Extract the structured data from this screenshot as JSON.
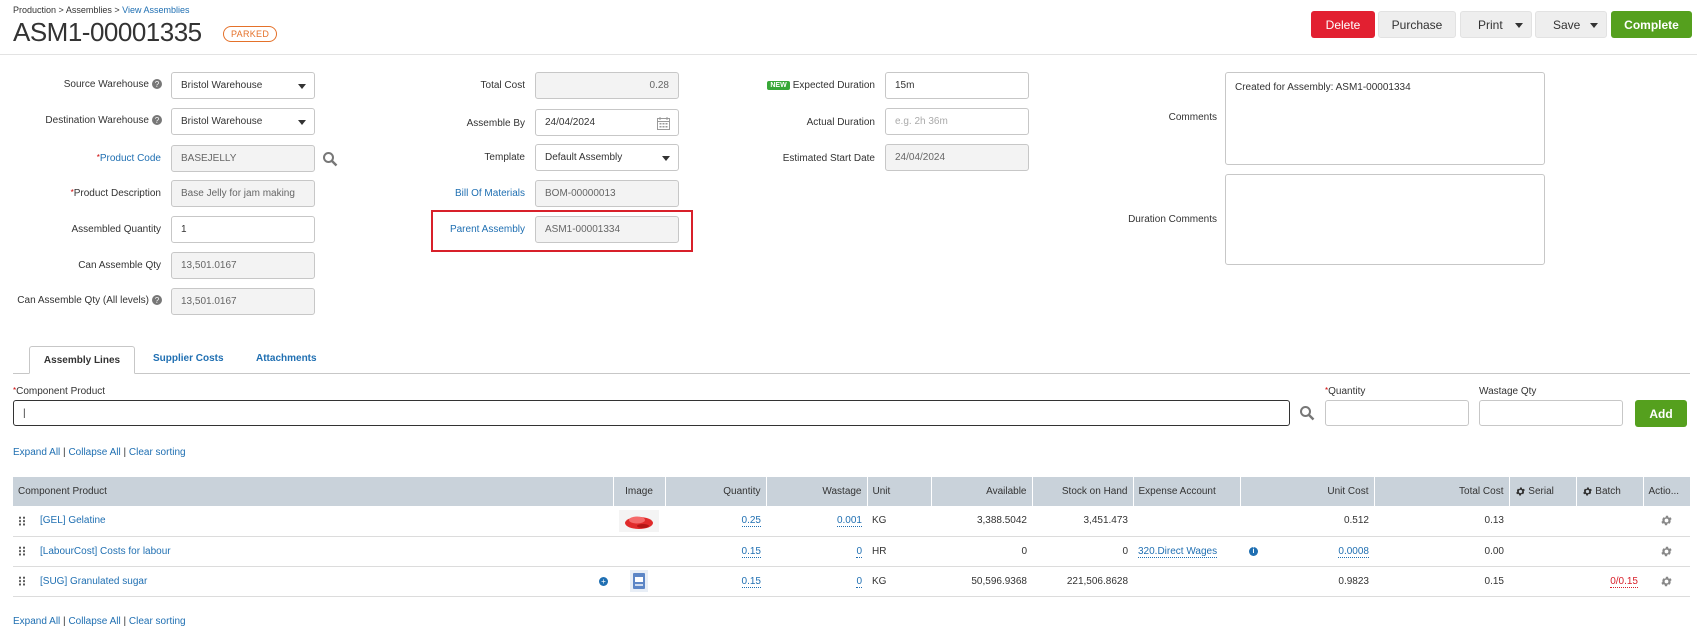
{
  "breadcrumb": {
    "item1": "Production",
    "item2": "Assemblies",
    "item3": "View Assemblies",
    "sep": ">"
  },
  "header": {
    "title": "ASM1-00001335",
    "status": "PARKED"
  },
  "toolbar": {
    "delete": "Delete",
    "purchase": "Purchase",
    "print": "Print",
    "save": "Save",
    "complete": "Complete"
  },
  "form": {
    "source_warehouse": {
      "label": "Source Warehouse",
      "value": "Bristol Warehouse"
    },
    "destination_warehouse": {
      "label": "Destination Warehouse",
      "value": "Bristol Warehouse"
    },
    "product_code": {
      "label": "Product Code",
      "value": "BASEJELLY"
    },
    "product_description": {
      "label": "Product Description",
      "value": "Base Jelly for jam making"
    },
    "assembled_quantity": {
      "label": "Assembled Quantity",
      "value": "1"
    },
    "can_assemble_qty": {
      "label": "Can Assemble Qty",
      "value": "13,501.0167"
    },
    "can_assemble_qty_all": {
      "label": "Can Assemble Qty (All levels)",
      "value": "13,501.0167"
    },
    "total_cost": {
      "label": "Total Cost",
      "value": "0.28"
    },
    "assemble_by": {
      "label": "Assemble By",
      "value": "24/04/2024"
    },
    "template": {
      "label": "Template",
      "value": "Default Assembly"
    },
    "bill_of_materials": {
      "label": "Bill Of Materials",
      "value": "BOM-00000013"
    },
    "parent_assembly": {
      "label": "Parent Assembly",
      "value": "ASM1-00001334"
    },
    "expected_duration": {
      "label": "Expected Duration",
      "value": "15m",
      "new_tag": "NEW"
    },
    "actual_duration": {
      "label": "Actual Duration",
      "placeholder": "e.g. 2h 36m"
    },
    "estimated_start_date": {
      "label": "Estimated Start Date",
      "value": "24/04/2024"
    },
    "comments": {
      "label": "Comments",
      "value": "Created for Assembly: ASM1-00001334"
    },
    "duration_comments": {
      "label": "Duration Comments",
      "value": ""
    }
  },
  "tabs": [
    {
      "label": "Assembly Lines"
    },
    {
      "label": "Supplier Costs"
    },
    {
      "label": "Attachments"
    }
  ],
  "add_line": {
    "component_label": "Component Product",
    "component_value": "|",
    "quantity_label": "Quantity",
    "wastage_label": "Wastage Qty",
    "add_button": "Add"
  },
  "grid_links": {
    "expand": "Expand All",
    "collapse": "Collapse All",
    "clear": "Clear sorting",
    "sep": "|"
  },
  "grid": {
    "columns": [
      "Component Product",
      "Image",
      "Quantity",
      "Wastage",
      "Unit",
      "Available",
      "Stock on Hand",
      "Expense Account",
      "Unit Cost",
      "Total Cost",
      "Serial",
      "Batch",
      "Actio..."
    ],
    "rows": [
      {
        "product": "[GEL] Gelatine",
        "quantity": "0.25",
        "wastage": "0.001",
        "unit": "KG",
        "available": "3,388.5042",
        "stock": "3,451.473",
        "expense": "",
        "unit_cost": "0.512",
        "total_cost": "0.13",
        "batch": ""
      },
      {
        "product": "[LabourCost] Costs for labour",
        "quantity": "0.15",
        "wastage": "0",
        "unit": "HR",
        "available": "0",
        "stock": "0",
        "expense": "320.Direct Wages",
        "unit_cost": "0.0008",
        "total_cost": "0.00",
        "batch": ""
      },
      {
        "product": "[SUG] Granulated sugar",
        "quantity": "0.15",
        "wastage": "0",
        "unit": "KG",
        "available": "50,596.9368",
        "stock": "221,506.8628",
        "expense": "",
        "unit_cost": "0.9823",
        "total_cost": "0.15",
        "batch": "0/0.15"
      }
    ]
  }
}
